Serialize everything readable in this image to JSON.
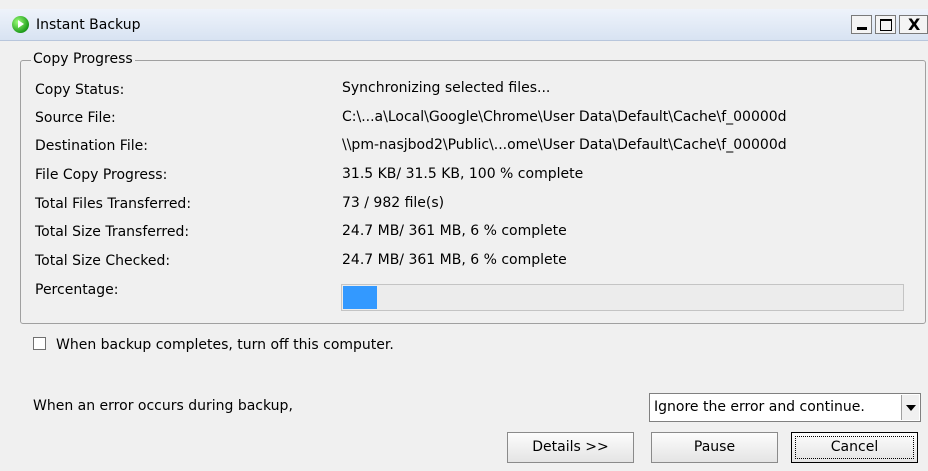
{
  "window": {
    "title": "Instant Backup"
  },
  "group": {
    "legend": "Copy Progress"
  },
  "rows": [
    {
      "label": "Copy Status:",
      "value": "Synchronizing selected files..."
    },
    {
      "label": "Source File:",
      "value": "C:\\...a\\Local\\Google\\Chrome\\User Data\\Default\\Cache\\f_00000d"
    },
    {
      "label": "Destination File:",
      "value": "\\\\pm-nasjbod2\\Public\\...ome\\User Data\\Default\\Cache\\f_00000d"
    },
    {
      "label": "File Copy Progress:",
      "value": "31.5 KB/ 31.5 KB,  100 % complete"
    },
    {
      "label": "Total Files Transferred:",
      "value": "73 / 982 file(s)"
    },
    {
      "label": "Total Size Transferred:",
      "value": "24.7 MB/ 361 MB,  6 % complete"
    },
    {
      "label": "Total Size Checked:",
      "value": "24.7 MB/ 361 MB,  6 % complete"
    }
  ],
  "percentage": {
    "label": "Percentage:",
    "fraction": 0.06,
    "color": "#3399ff"
  },
  "shutdown": {
    "label": "When backup completes, turn off this computer.",
    "checked": false
  },
  "error": {
    "label": "When an error occurs during backup,",
    "selected": "Ignore the error and continue."
  },
  "buttons": {
    "details": "Details >>",
    "pause": "Pause",
    "cancel": "Cancel"
  }
}
